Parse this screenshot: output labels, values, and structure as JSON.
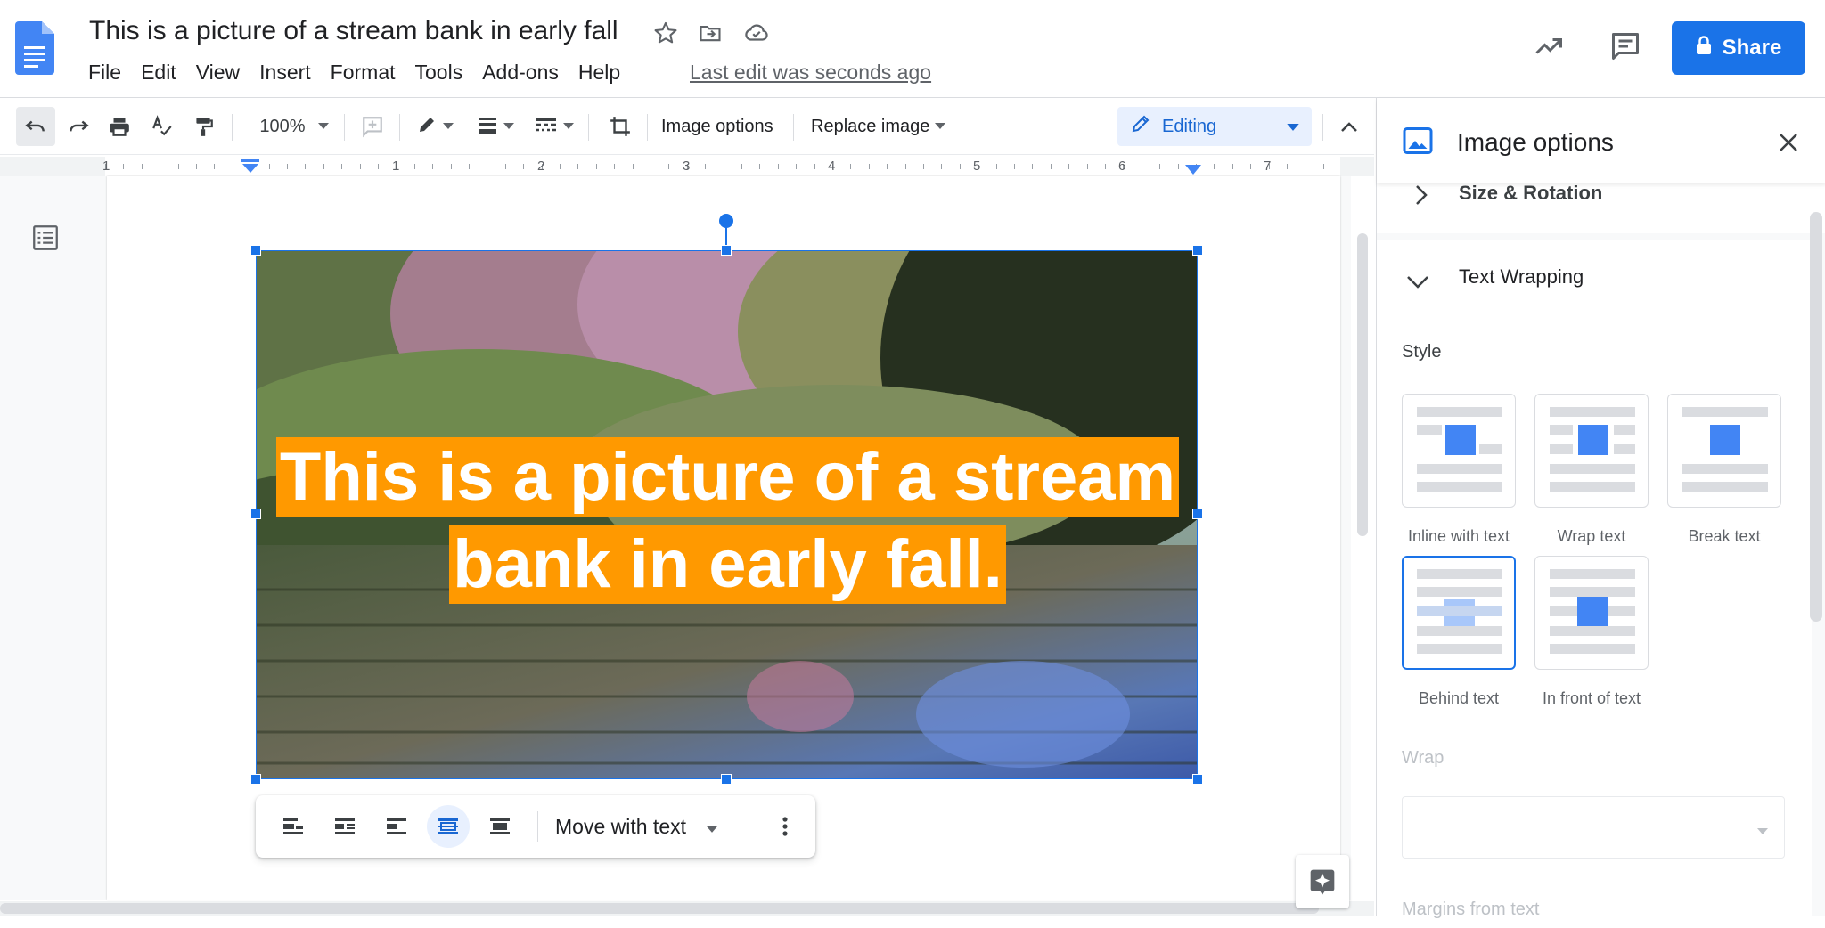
{
  "header": {
    "doc_title": "This is a picture of a stream bank in early fall",
    "menus": [
      "File",
      "Edit",
      "View",
      "Insert",
      "Format",
      "Tools",
      "Add-ons",
      "Help"
    ],
    "last_edit": "Last edit was seconds ago",
    "share_label": "Share"
  },
  "toolbar": {
    "zoom": "100%",
    "image_options_label": "Image options",
    "replace_image_label": "Replace image",
    "mode_label": "Editing"
  },
  "ruler": {
    "numbers": [
      "1",
      "1",
      "2",
      "3",
      "4",
      "5",
      "6",
      "7"
    ]
  },
  "image": {
    "overlay_line1": "This is a picture of a stream",
    "overlay_line2": "bank in early fall."
  },
  "image_toolbar": {
    "position_label": "Move with text"
  },
  "panel": {
    "title": "Image options",
    "size_rotation_label": "Size & Rotation",
    "text_wrapping_label": "Text Wrapping",
    "style_label": "Style",
    "styles": [
      "Inline with text",
      "Wrap text",
      "Break text",
      "Behind text",
      "In front of text"
    ],
    "selected_style": "Behind text",
    "wrap_label": "Wrap",
    "margins_label": "Margins from text"
  },
  "colors": {
    "accent": "#1a73e8",
    "overlay_bg": "#ff9900"
  }
}
